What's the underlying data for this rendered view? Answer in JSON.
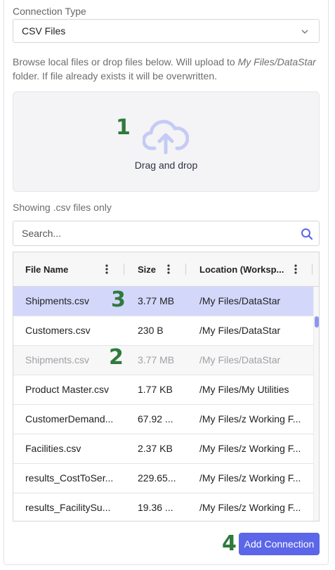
{
  "connection": {
    "label": "Connection Type",
    "selected": "CSV Files"
  },
  "help": {
    "before": "Browse local files or drop files below. Will upload to ",
    "path": "My Files/DataStar",
    "after": " folder. If file already exists it will be overwritten."
  },
  "dropzone": {
    "text": "Drag and drop",
    "icon": "cloud-upload-icon"
  },
  "filter_note": "Showing .csv files only",
  "search": {
    "placeholder": "Search...",
    "icon": "search-icon"
  },
  "table": {
    "columns": [
      "File Name",
      "Size",
      "Location (Worksp..."
    ],
    "rows": [
      {
        "name": "Shipments.csv",
        "size": "3.77 MB",
        "location": "/My Files/DataStar",
        "state": "selected"
      },
      {
        "name": "Customers.csv",
        "size": "230 B",
        "location": "/My Files/DataStar",
        "state": "normal"
      },
      {
        "name": "Shipments.csv",
        "size": "3.77 MB",
        "location": "/My Files/DataStar",
        "state": "disabled"
      },
      {
        "name": "Product Master.csv",
        "size": "1.77 KB",
        "location": "/My Files/My Utilities",
        "state": "normal"
      },
      {
        "name": "CustomerDemand...",
        "size": "67.92 ...",
        "location": "/My Files/z Working F...",
        "state": "normal"
      },
      {
        "name": "Facilities.csv",
        "size": "2.37 KB",
        "location": "/My Files/z Working F...",
        "state": "normal"
      },
      {
        "name": "results_CostToSer...",
        "size": "229.65...",
        "location": "/My Files/z Working F...",
        "state": "normal"
      },
      {
        "name": "results_FacilitySu...",
        "size": "19.36 ...",
        "location": "/My Files/z Working F...",
        "state": "normal"
      }
    ]
  },
  "add_button": "Add Connection",
  "annotations": [
    "1",
    "2",
    "3",
    "4"
  ],
  "colors": {
    "accent": "#5b66e8",
    "selected_row": "#d3d8fb",
    "annotation": "#2f7a3c",
    "dropzone_bg": "#f4f4f6"
  }
}
